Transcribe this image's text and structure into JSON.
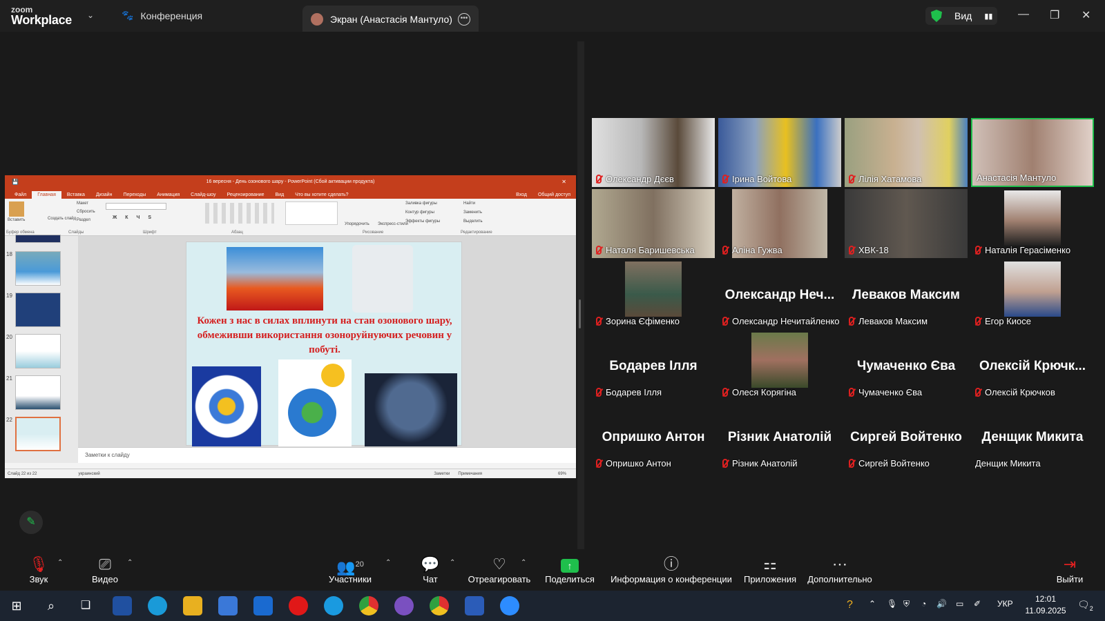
{
  "app": {
    "logo_top": "zoom",
    "logo_bottom": "Workplace",
    "conference_tab": "Конференция",
    "screen_tab": "Экран (Анастасія Мантуло)",
    "view_label": "Вид"
  },
  "colors": {
    "accent_green": "#1fbf4c",
    "muted_red": "#e02020",
    "ppt_orange": "#c43e1c"
  },
  "ppt": {
    "title": "16 вересня - День озонового шару - PowerPoint (Сбой активации продукта)",
    "tabs": [
      "Файл",
      "Главная",
      "Вставка",
      "Дизайн",
      "Переходы",
      "Анимация",
      "Слайд-шоу",
      "Рецензирование",
      "Вид",
      "Что вы хотите сделать?"
    ],
    "login": "Вход",
    "share": "Общий доступ",
    "ribbon": {
      "paste": "Вставить",
      "create_slide": "Создать слайд",
      "layout": "Макет",
      "reset": "Сбросить",
      "section": "Раздел",
      "arrange": "Упорядочить",
      "quick_styles": "Экспресс-стили",
      "fill": "Заливка фигуры",
      "outline": "Контур фигуры",
      "effects": "Эффекты фигуры",
      "find": "Найти",
      "replace": "Заменить",
      "select": "Выделить"
    },
    "groups": [
      "Буфер обмена",
      "Слайды",
      "Шрифт",
      "Абзац",
      "Рисование",
      "Редактирование"
    ],
    "thumb_numbers": [
      "18",
      "19",
      "20",
      "21",
      "22"
    ],
    "slide_text": "Кожен з нас в силах вплинути на стан озонового шару, обмеживши використання озоноруйнуючих речовин у побуті.",
    "notes_placeholder": "Заметки к слайду",
    "status_slide": "Слайд 22 из 22",
    "status_lang": "украинский",
    "status_notes": "Заметки",
    "status_comments": "Примечания",
    "zoom": "69%"
  },
  "participants": [
    {
      "name": "Олександр Дєєв",
      "video": true
    },
    {
      "name": "Ірина Войтова",
      "video": true
    },
    {
      "name": "Лілія Хатамова",
      "video": true
    },
    {
      "name": "Анастасія Мантуло",
      "video": true
    },
    {
      "name": "Наталя Баришевська",
      "video": true
    },
    {
      "name": "Аліна Гужва",
      "video": true
    },
    {
      "name": "ХВК-18",
      "video": true
    },
    {
      "name": "Наталія Герасіменко",
      "video": true
    },
    {
      "name": "Зорина Єфіменко",
      "video": true
    },
    {
      "name": "Олександр Нечитайленко",
      "big": "Олександр Неч..."
    },
    {
      "name": "Леваков Максим",
      "big": "Леваков Максим"
    },
    {
      "name": "Егор Киосе",
      "video": true
    },
    {
      "name": "Бодарев Ілля",
      "big": "Бодарев Ілля"
    },
    {
      "name": "Олеся Корягіна",
      "video": true
    },
    {
      "name": "Чумаченко Єва",
      "big": "Чумаченко Єва"
    },
    {
      "name": "Олексій Крючков",
      "big": "Олексій Крючк..."
    },
    {
      "name": "Опришко Антон",
      "big": "Опришко Антон"
    },
    {
      "name": "Різник Анатолій",
      "big": "Різник Анатолій"
    },
    {
      "name": "Сиргей Войтенко",
      "big": "Сиргей Войтенко"
    },
    {
      "name": "Денщик Микита",
      "big": "Денщик Микита",
      "unmuted": true
    }
  ],
  "toolbar": {
    "audio": "Звук",
    "video": "Видео",
    "participants": "Участники",
    "participants_count": "20",
    "chat": "Чат",
    "react": "Отреагировать",
    "share": "Поделиться",
    "info": "Информация о конференции",
    "apps": "Приложения",
    "more": "Дополнительно",
    "leave": "Выйти"
  },
  "taskbar": {
    "lang": "УКР",
    "time": "12:01",
    "date": "11.09.2025",
    "notifications": "2"
  }
}
